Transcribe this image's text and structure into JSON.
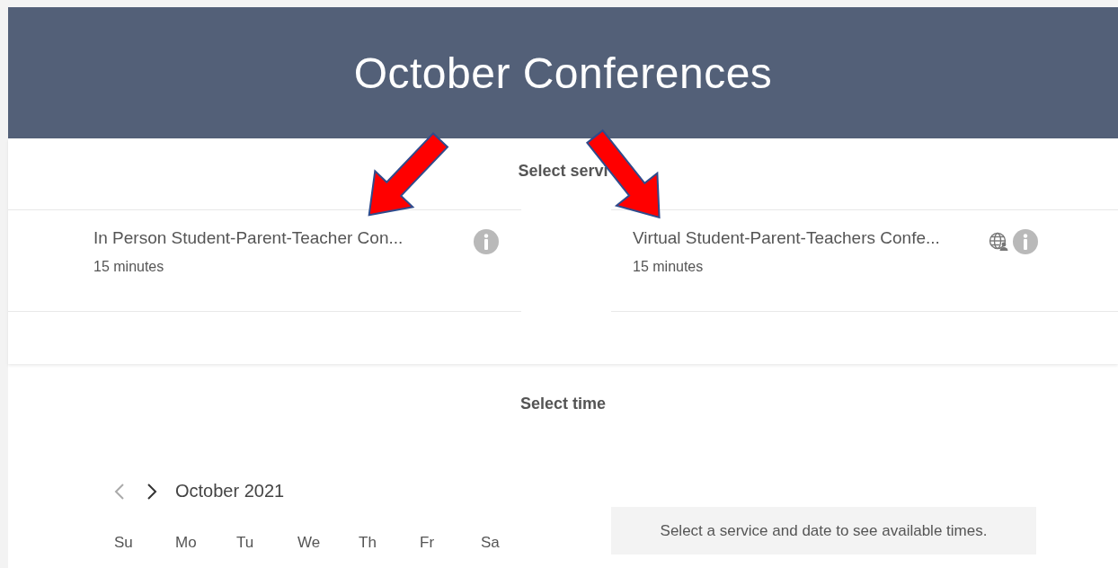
{
  "header": {
    "title": "October Conferences"
  },
  "services": {
    "heading": "Select servi",
    "items": [
      {
        "kind": "in-person",
        "name": "In Person Student-Parent-Teacher Con...",
        "duration": "15 minutes"
      },
      {
        "kind": "online",
        "name": "Virtual Student-Parent-Teachers Confe...",
        "duration": "15 minutes"
      }
    ]
  },
  "time": {
    "heading": "Select time",
    "previous_disabled": true,
    "month": "October 2021",
    "weekdays": [
      "Su",
      "Mo",
      "Tu",
      "We",
      "Th",
      "Fr",
      "Sa"
    ],
    "message": "Select a service and date to see available times."
  }
}
